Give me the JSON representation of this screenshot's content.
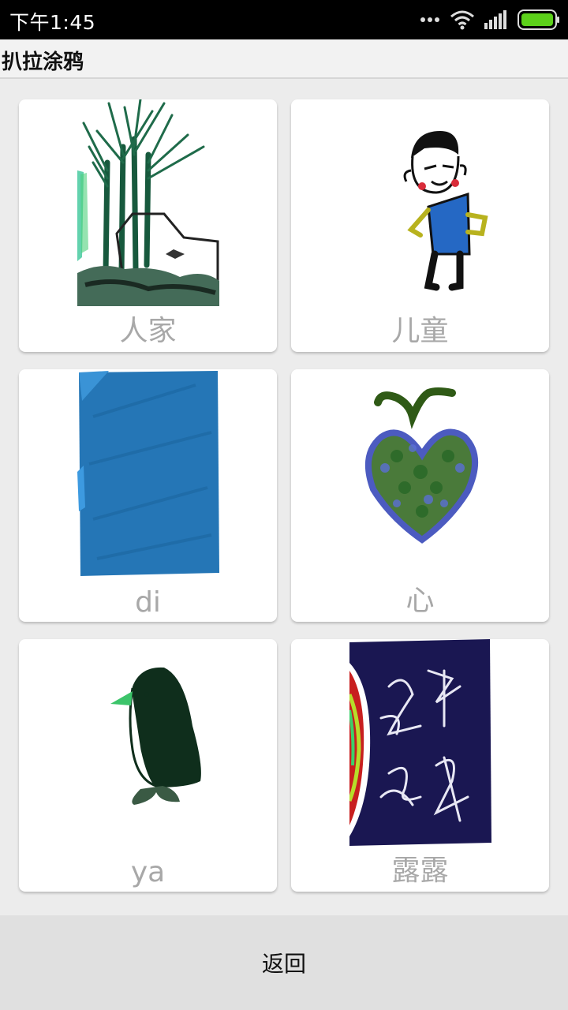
{
  "status_bar": {
    "time": "下午1:45",
    "icons": [
      "more-dots-icon",
      "wifi-icon",
      "signal-icon",
      "battery-icon"
    ],
    "battery_color": "#5cd11a"
  },
  "app": {
    "title": "扒拉涂鸦"
  },
  "drawings": [
    {
      "label": "人家",
      "art": "trees-and-house"
    },
    {
      "label": "儿童",
      "art": "child-figure"
    },
    {
      "label": "di",
      "art": "blue-rectangle"
    },
    {
      "label": "心",
      "art": "green-heart"
    },
    {
      "label": "ya",
      "art": "penguin"
    },
    {
      "label": "露露",
      "art": "navy-calligraphy"
    }
  ],
  "footer": {
    "back_label": "返回"
  }
}
